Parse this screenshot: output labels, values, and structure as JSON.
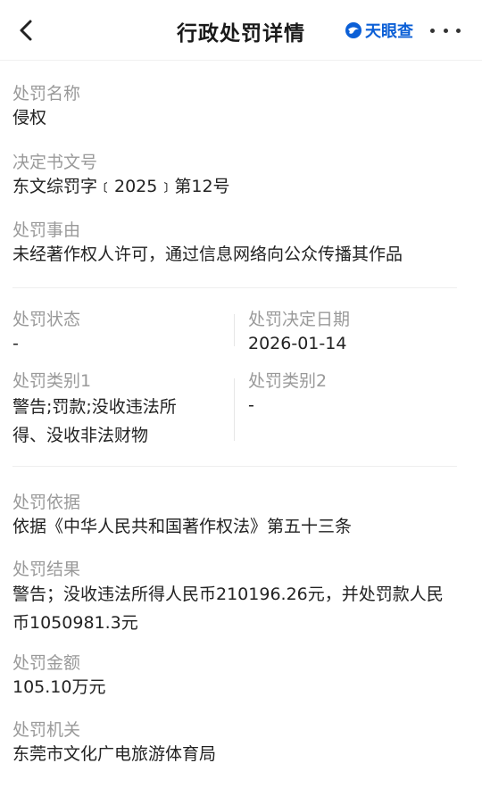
{
  "header": {
    "title": "行政处罚详情",
    "brand": "天眼查",
    "brand_color": "#0b5fd6",
    "back_icon": "chevron-left-icon",
    "more_icon": "more-dots-icon"
  },
  "fields": {
    "name_label": "处罚名称",
    "name_value": "侵权",
    "doc_label": "决定书文号",
    "doc_value": "东文综罚字﹝2025﹞第12号",
    "reason_label": "处罚事由",
    "reason_value": "未经著作权人许可，通过信息网络向公众传播其作品",
    "status_label": "处罚状态",
    "status_value": "-",
    "date_label": "处罚决定日期",
    "date_value": "2026-01-14",
    "type1_label": "处罚类别1",
    "type1_value": "警告;罚款;没收违法所得、没收非法财物",
    "type2_label": "处罚类别2",
    "type2_value": "-",
    "basis_label": "处罚依据",
    "basis_value": "依据《中华人民共和国著作权法》第五十三条",
    "result_label": "处罚结果",
    "result_value": "警告；没收违法所得人民币210196.26元，并处罚款人民币1050981.3元",
    "amount_label": "处罚金额",
    "amount_value": "105.10万元",
    "authority_label": "处罚机关",
    "authority_value": "东莞市文化广电旅游体育局"
  }
}
